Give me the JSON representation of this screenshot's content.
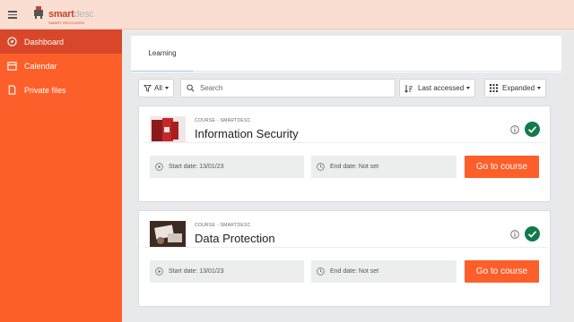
{
  "brand": {
    "name_main": "smart",
    "name_light": "desc",
    "tagline": "SMART RECOVERS"
  },
  "sidebar": {
    "items": [
      {
        "label": "Dashboard",
        "icon": "compass-icon",
        "active": true
      },
      {
        "label": "Calendar",
        "icon": "calendar-icon",
        "active": false
      },
      {
        "label": "Private files",
        "icon": "file-icon",
        "active": false
      }
    ]
  },
  "tabs": [
    {
      "label": "Learning"
    }
  ],
  "filters": {
    "all_label": "All",
    "search_placeholder": "Search",
    "sort_label": "Last accessed",
    "view_label": "Expanded"
  },
  "courses": [
    {
      "category": "COURSE - SMARTDESC",
      "title": "Information Security",
      "start_date": "Start date: 13/01/23",
      "end_date": "End date: Not set",
      "button": "Go to course",
      "completed": true
    },
    {
      "category": "COURSE - SMARTDESC",
      "title": "Data Protection",
      "start_date": "Start date: 13/01/23",
      "end_date": "End date: Not set",
      "button": "Go to course",
      "completed": true
    }
  ],
  "colors": {
    "accent": "#fd5f2a",
    "active_nav": "#d8472a",
    "topbar": "#fbded2",
    "success": "#127a4b"
  }
}
